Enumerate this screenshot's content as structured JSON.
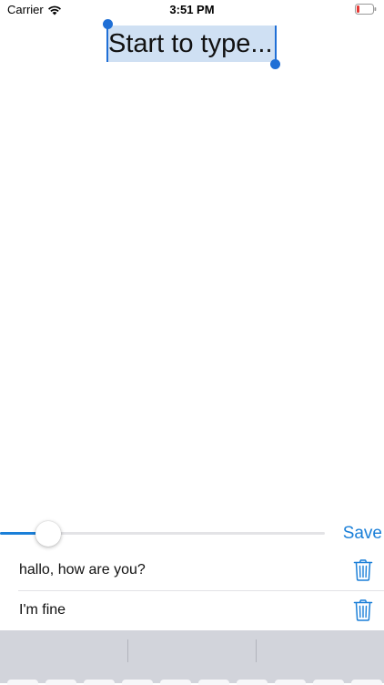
{
  "status_bar": {
    "carrier": "Carrier",
    "time": "3:51 PM",
    "battery_color": "#e53935"
  },
  "editor": {
    "text": "Start to type...",
    "selection_color": "#cfe0f3",
    "handle_color": "#1f6fd6"
  },
  "slider": {
    "value": 0.12
  },
  "toolbar": {
    "save_label": "Save"
  },
  "list": {
    "items": [
      {
        "text": "hallo, how are you?"
      },
      {
        "text": "I'm fine"
      }
    ]
  },
  "accent_color": "#1a7fd8"
}
